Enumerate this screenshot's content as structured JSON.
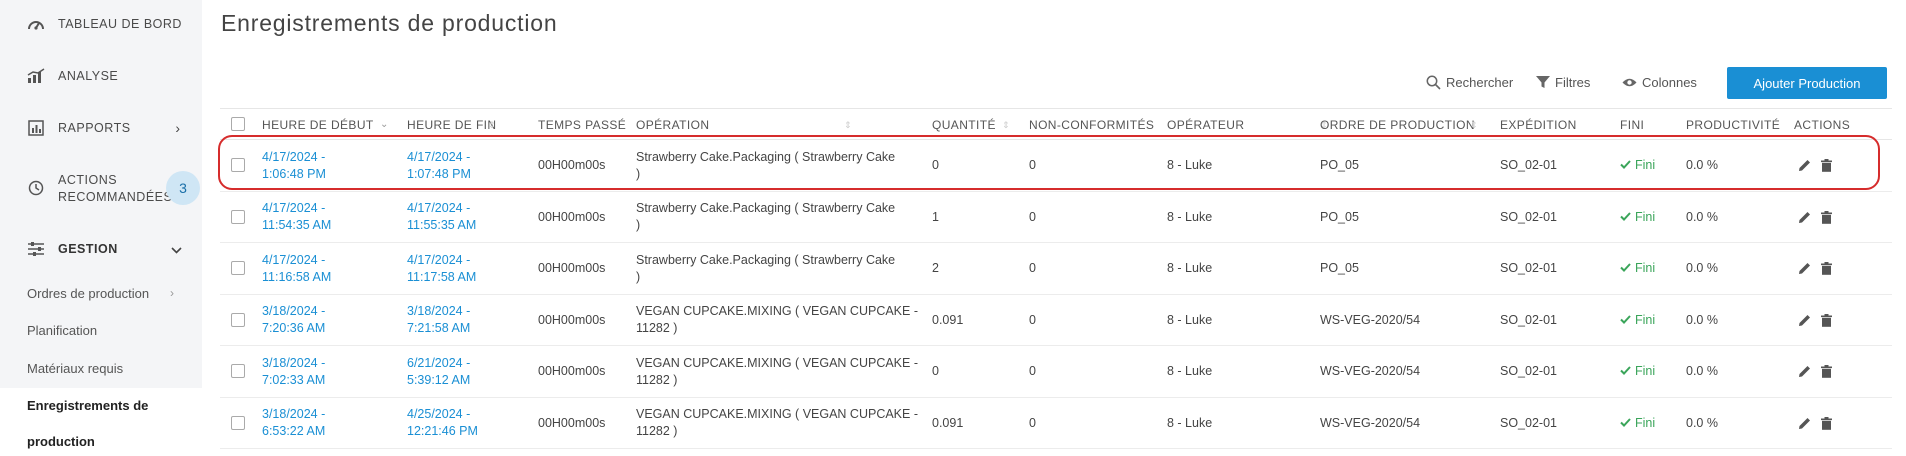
{
  "sidebar": {
    "items": [
      {
        "label": "TABLEAU DE BORD",
        "icon": "gauge-icon"
      },
      {
        "label": "ANALYSE",
        "icon": "bar-chart-icon"
      },
      {
        "label": "RAPPORTS",
        "icon": "report-icon"
      },
      {
        "label": "ACTIONS RECOMMANDÉES",
        "label_line1": "ACTIONS",
        "label_line2": "RECOMMANDÉES",
        "icon": "history-icon",
        "badge": "3"
      },
      {
        "label": "GESTION",
        "icon": "sliders-icon"
      }
    ],
    "sub_items": [
      {
        "label": "Ordres de production"
      },
      {
        "label": "Planification"
      },
      {
        "label": "Matériaux requis"
      },
      {
        "label_line1": "Enregistrements de",
        "label_line2": "production"
      }
    ]
  },
  "main": {
    "title": "Enregistrements de production",
    "toolbar": {
      "search": "Rechercher",
      "filters": "Filtres",
      "columns": "Colonnes",
      "add": "Ajouter Production"
    },
    "columns": [
      "HEURE DE DÉBUT",
      "HEURE DE FIN",
      "TEMPS PASSÉ",
      "OPÉRATION",
      "QUANTITÉ",
      "NON-CONFORMITÉS",
      "OPÉRATEUR",
      "ORDRE DE PRODUCTION",
      "EXPÉDITION",
      "FINI",
      "PRODUCTIVITÉ",
      "ACTIONS"
    ],
    "rows": [
      {
        "start1": "4/17/2024 -",
        "start2": "1:06:48 PM",
        "end1": "4/17/2024 -",
        "end2": "1:07:48 PM",
        "time": "00H00m00s",
        "op1": "Strawberry Cake.Packaging ( Strawberry Cake",
        "op2": ")",
        "qty": "0",
        "nc": "0",
        "operator": "8 - Luke",
        "order": "PO_05",
        "shipment": "SO_02-01",
        "fini": "Fini",
        "prod": "0.0 %"
      },
      {
        "start1": "4/17/2024 -",
        "start2": "11:54:35 AM",
        "end1": "4/17/2024 -",
        "end2": "11:55:35 AM",
        "time": "00H00m00s",
        "op1": "Strawberry Cake.Packaging ( Strawberry Cake",
        "op2": ")",
        "qty": "1",
        "nc": "0",
        "operator": "8 - Luke",
        "order": "PO_05",
        "shipment": "SO_02-01",
        "fini": "Fini",
        "prod": "0.0 %"
      },
      {
        "start1": "4/17/2024 -",
        "start2": "11:16:58 AM",
        "end1": "4/17/2024 -",
        "end2": "11:17:58 AM",
        "time": "00H00m00s",
        "op1": "Strawberry Cake.Packaging ( Strawberry Cake",
        "op2": ")",
        "qty": "2",
        "nc": "0",
        "operator": "8 - Luke",
        "order": "PO_05",
        "shipment": "SO_02-01",
        "fini": "Fini",
        "prod": "0.0 %"
      },
      {
        "start1": "3/18/2024 -",
        "start2": "7:20:36 AM",
        "end1": "3/18/2024 -",
        "end2": "7:21:58 AM",
        "time": "00H00m00s",
        "op1": "VEGAN CUPCAKE.MIXING ( VEGAN CUPCAKE -",
        "op2": "11282 )",
        "qty": "0.091",
        "nc": "0",
        "operator": "8 - Luke",
        "order": "WS-VEG-2020/54",
        "shipment": "SO_02-01",
        "fini": "Fini",
        "prod": "0.0 %"
      },
      {
        "start1": "3/18/2024 -",
        "start2": "7:02:33 AM",
        "end1": "6/21/2024 -",
        "end2": "5:39:12 AM",
        "time": "00H00m00s",
        "op1": "VEGAN CUPCAKE.MIXING ( VEGAN CUPCAKE -",
        "op2": "11282 )",
        "qty": "0",
        "nc": "0",
        "operator": "8 - Luke",
        "order": "WS-VEG-2020/54",
        "shipment": "SO_02-01",
        "fini": "Fini",
        "prod": "0.0 %"
      },
      {
        "start1": "3/18/2024 -",
        "start2": "6:53:22 AM",
        "end1": "4/25/2024 -",
        "end2": "12:21:46 PM",
        "time": "00H00m00s",
        "op1": "VEGAN CUPCAKE.MIXING ( VEGAN CUPCAKE -",
        "op2": "11282 )",
        "qty": "0.091",
        "nc": "0",
        "operator": "8 - Luke",
        "order": "WS-VEG-2020/54",
        "shipment": "SO_02-01",
        "fini": "Fini",
        "prod": "0.0 %"
      }
    ]
  },
  "colors": {
    "accent": "#1a8fd4",
    "success": "#3aa55a",
    "highlight": "#d62c2c",
    "sidebar": "#f4f5f7"
  }
}
